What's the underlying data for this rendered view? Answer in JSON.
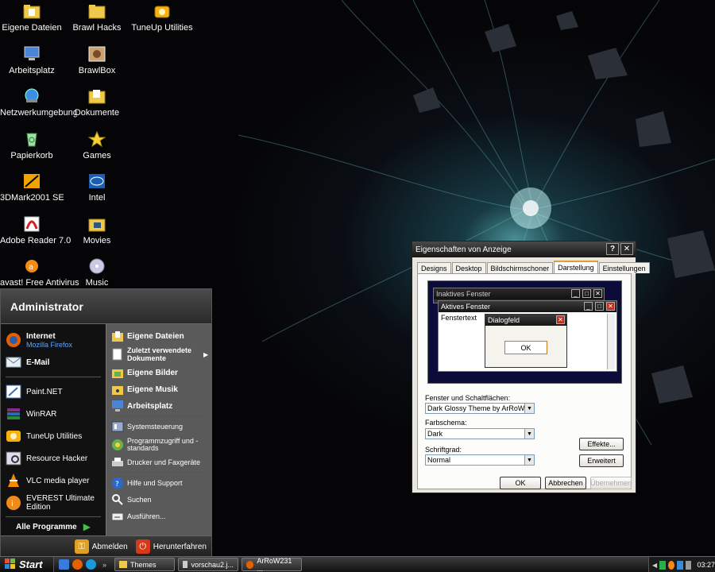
{
  "desktop_icons": [
    {
      "label": "Eigene Dateien",
      "icon": "folder-documents-icon"
    },
    {
      "label": "Brawl Hacks",
      "icon": "folder-icon"
    },
    {
      "label": "TuneUp Utilities",
      "icon": "tuneup-icon"
    },
    {
      "label": "Arbeitsplatz",
      "icon": "my-computer-icon"
    },
    {
      "label": "BrawlBox",
      "icon": "brawlbox-icon"
    },
    {
      "label": "Netzwerkumgebung",
      "icon": "network-icon"
    },
    {
      "label": "Dokumente",
      "icon": "folder-documents-icon"
    },
    {
      "label": "Papierkorb",
      "icon": "recycle-bin-icon"
    },
    {
      "label": "Games",
      "icon": "star-icon"
    },
    {
      "label": "3DMark2001 SE",
      "icon": "3dmark-icon"
    },
    {
      "label": "Intel",
      "icon": "intel-icon"
    },
    {
      "label": "Adobe Reader 7.0",
      "icon": "adobe-reader-icon"
    },
    {
      "label": "Movies",
      "icon": "folder-movies-icon"
    },
    {
      "label": "avast! Free Antivirus",
      "icon": "avast-icon"
    },
    {
      "label": "Music",
      "icon": "music-disc-icon"
    }
  ],
  "start_menu": {
    "user": "Administrator",
    "pinned": [
      {
        "title": "Internet",
        "subtitle": "Mozilla Firefox",
        "icon": "firefox-icon"
      },
      {
        "title": "E-Mail",
        "subtitle": "",
        "icon": "email-icon"
      }
    ],
    "recent": [
      {
        "label": "Paint.NET",
        "icon": "paintnet-icon"
      },
      {
        "label": "WinRAR",
        "icon": "winrar-icon"
      },
      {
        "label": "TuneUp Utilities",
        "icon": "tuneup-icon"
      },
      {
        "label": "Resource Hacker",
        "icon": "resource-hacker-icon"
      },
      {
        "label": "VLC media player",
        "icon": "vlc-icon"
      },
      {
        "label": "EVEREST Ultimate Edition",
        "icon": "everest-icon"
      }
    ],
    "all_programs": "Alle Programme",
    "right_items": [
      {
        "label": "Eigene Dateien",
        "icon": "folder-documents-icon"
      },
      {
        "label": "Zuletzt verwendete Dokumente",
        "icon": "recent-documents-icon"
      },
      {
        "label": "Eigene Bilder",
        "icon": "folder-pictures-icon"
      },
      {
        "label": "Eigene Musik",
        "icon": "folder-music-icon"
      },
      {
        "label": "Arbeitsplatz",
        "icon": "my-computer-icon"
      },
      {
        "label": "Systemsteuerung",
        "icon": "control-panel-icon"
      },
      {
        "label": "Programmzugriff und -standards",
        "icon": "program-access-icon"
      },
      {
        "label": "Drucker und Faxgeräte",
        "icon": "printer-icon"
      },
      {
        "label": "Hilfe und Support",
        "icon": "help-icon"
      },
      {
        "label": "Suchen",
        "icon": "search-icon"
      },
      {
        "label": "Ausführen...",
        "icon": "run-icon"
      }
    ],
    "logoff": "Abmelden",
    "shutdown": "Herunterfahren"
  },
  "dialog": {
    "title": "Eigenschaften von Anzeige",
    "tabs": [
      "Designs",
      "Desktop",
      "Bildschirmschoner",
      "Darstellung",
      "Einstellungen"
    ],
    "active_tab": "Darstellung",
    "preview": {
      "inactive_window": "Inaktives Fenster",
      "active_window": "Aktives Fenster",
      "window_text": "Fenstertext",
      "dialog_title": "Dialogfeld",
      "dialog_ok": "OK"
    },
    "windows_buttons_label": "Fenster und Schaltflächen:",
    "windows_buttons_value": "Dark Glossy Theme by ArRoW",
    "color_scheme_label": "Farbschema:",
    "color_scheme_value": "Dark",
    "font_size_label": "Schriftgrad:",
    "font_size_value": "Normal",
    "effects_button": "Effekte...",
    "advanced_button": "Erweitert",
    "ok_button": "OK",
    "cancel_button": "Abbrechen",
    "apply_button": "Übernehmen"
  },
  "taskbar": {
    "start_label": "Start",
    "quick_launch": [
      "ie-icon",
      "firefox-icon",
      "skype-icon",
      "show-desktop-icon"
    ],
    "overflow": "»",
    "tasks": [
      {
        "label": "Themes",
        "icon": "folder-icon"
      },
      {
        "label": "vorschau2.j...",
        "icon": "image-icon"
      },
      {
        "label": "ArRoW231 ...",
        "icon": "firefox-icon"
      }
    ],
    "clock": "03:27"
  }
}
